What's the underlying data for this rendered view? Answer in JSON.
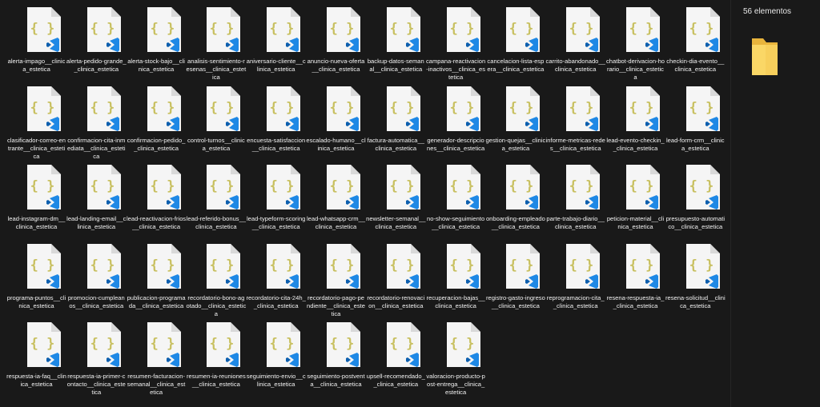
{
  "details": {
    "count_label": "56 elementos",
    "preview_icon": "folder-icon"
  },
  "icon": {
    "type": "json-file-icon",
    "badge": "vscode-icon",
    "brace_color": "#c8c060",
    "badge_color": "#1e88e5",
    "page_color": "#f5f5f5"
  },
  "files": [
    "alerta-impago__clinica_estetica",
    "alerta-pedido-grande__clinica_estetica",
    "alerta-stock-bajo__clinica_estetica",
    "analisis-sentimiento-resenas__clinica_estetica",
    "aniversario-cliente__clinica_estetica",
    "anuncio-nueva-oferta__clinica_estetica",
    "backup-datos-semanal__clinica_estetica",
    "campana-reactivacion-inactivos__clinica_estetica",
    "cancelacion-lista-espera__clinica_estetica",
    "carrito-abandonado__clinica_estetica",
    "chatbot-derivacion-horario__clinica_estetica",
    "checkin-dia-evento__clinica_estetica",
    "clasificador-correo-entrante__clinica_estetica",
    "confirmacion-cita-inmediata__clinica_estetica",
    "confirmacion-pedido__clinica_estetica",
    "control-turnos__clinica_estetica",
    "encuesta-satisfaccion__clinica_estetica",
    "escalado-humano__clinica_estetica",
    "factura-automatica__clinica_estetica",
    "generador-descripciones__clinica_estetica",
    "gestion-quejas__clinica_estetica",
    "informe-metricas-redes__clinica_estetica",
    "lead-evento-checkin__clinica_estetica",
    "lead-form-crm__clinica_estetica",
    "lead-instagram-dm__clinica_estetica",
    "lead-landing-email__clinica_estetica",
    "lead-reactivacion-frios__clinica_estetica",
    "lead-referido-bonus__clinica_estetica",
    "lead-typeform-scoring__clinica_estetica",
    "lead-whatsapp-crm__clinica_estetica",
    "newsletter-semanal__clinica_estetica",
    "no-show-seguimiento__clinica_estetica",
    "onboarding-empleado__clinica_estetica",
    "parte-trabajo-diario__clinica_estetica",
    "peticion-material__clinica_estetica",
    "presupuesto-automatico__clinica_estetica",
    "programa-puntos__clinica_estetica",
    "promocion-cumpleanos__clinica_estetica",
    "publicacion-programada__clinica_estetica",
    "recordatorio-bono-agotado__clinica_estetica",
    "recordatorio-cita-24h__clinica_estetica",
    "recordatorio-pago-pendiente__clinica_estetica",
    "recordatorio-renovacion__clinica_estetica",
    "recuperacion-bajas__clinica_estetica",
    "registro-gasto-ingreso__clinica_estetica",
    "reprogramacion-cita__clinica_estetica",
    "resena-respuesta-ia__clinica_estetica",
    "resena-solicitud__clinica_estetica",
    "respuesta-ia-faq__clinica_estetica",
    "respuesta-ia-primer-contacto__clinica_estetica",
    "resumen-facturacion-semanal__clinica_estetica",
    "resumen-ia-reuniones__clinica_estetica",
    "seguimiento-envio__clinica_estetica",
    "seguimiento-postventa__clinica_estetica",
    "upsell-recomendado__clinica_estetica",
    "valoracion-producto-post-entrega__clinica_estetica"
  ]
}
